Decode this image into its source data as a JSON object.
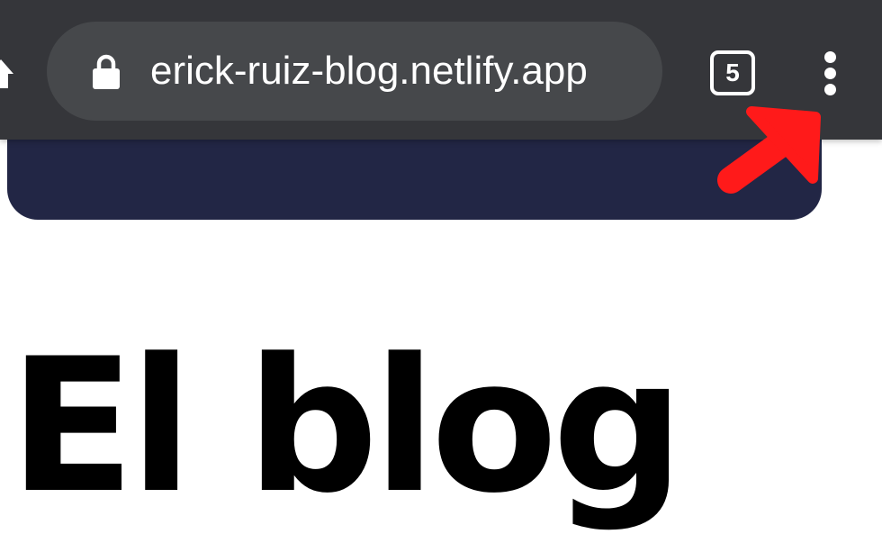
{
  "browser": {
    "address_bar": {
      "url": "erick-ruiz-blog.netlify.app",
      "secure_icon": "lock-icon"
    },
    "home_icon": "home-icon",
    "tab_count": "5",
    "menu_icon": "more-vert-icon",
    "colors": {
      "toolbar": "#35363a",
      "address_bar": "#46484b",
      "text": "#ffffff"
    }
  },
  "page": {
    "hero_color": "#222645",
    "heading": "El blog"
  },
  "annotation": {
    "icon": "red-arrow-annotation",
    "color": "#ff1a1a"
  }
}
